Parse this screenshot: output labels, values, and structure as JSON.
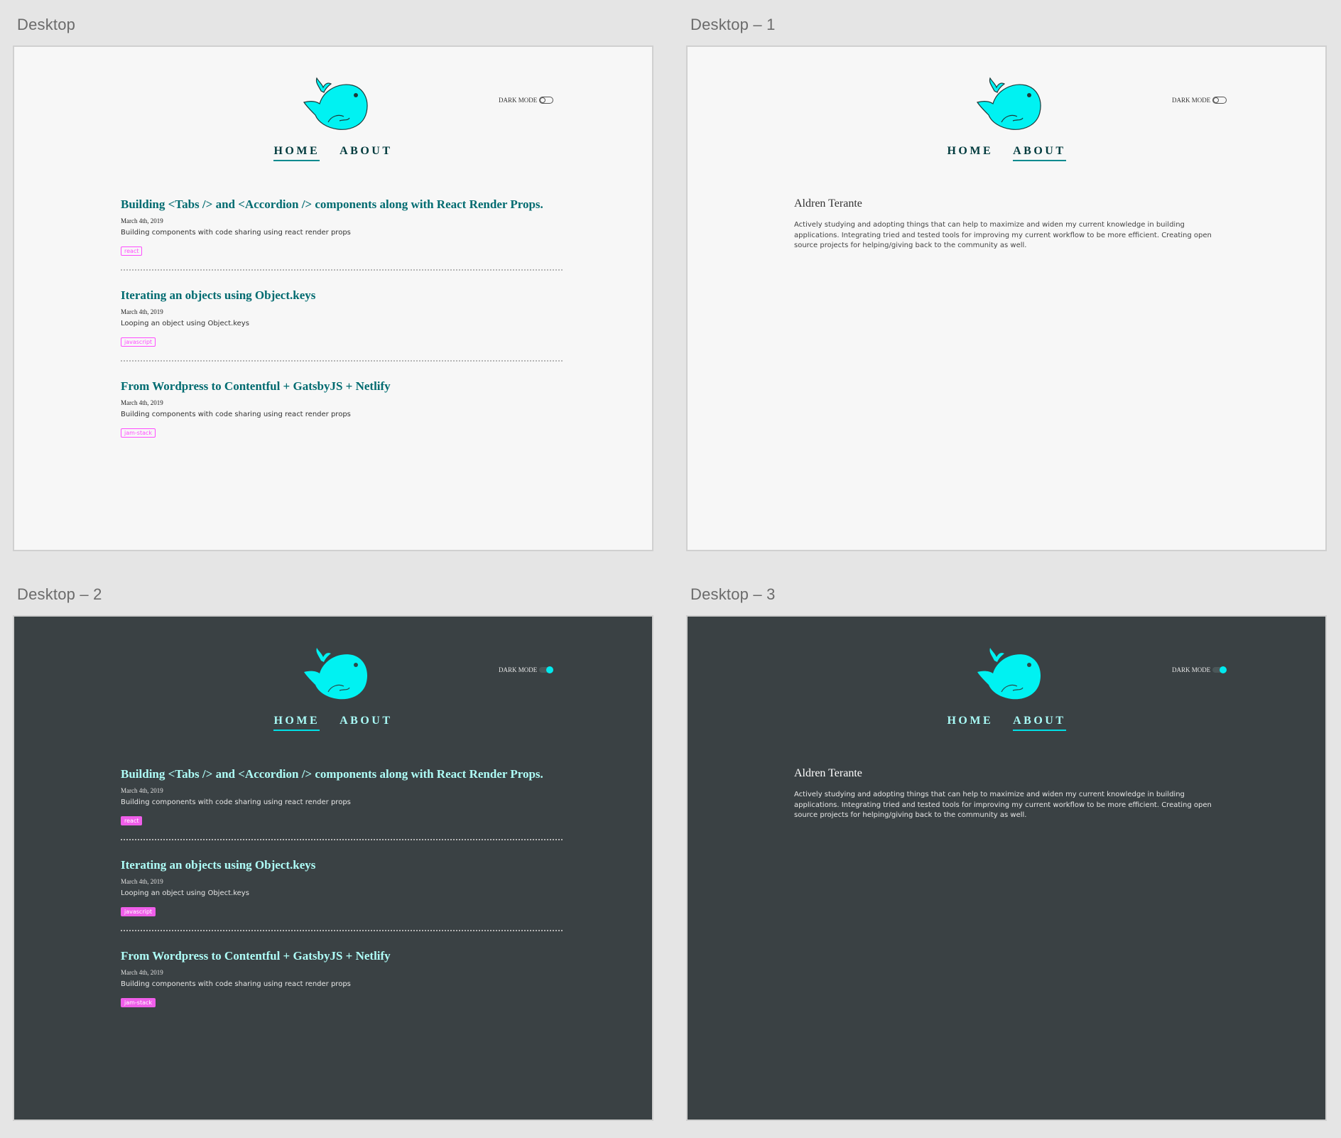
{
  "artboard_titles": [
    "Desktop",
    "Desktop – 1",
    "Desktop – 2",
    "Desktop – 3"
  ],
  "colors": {
    "canvas": "#e5e5e5",
    "light_bg": "#f7f7f7",
    "dark_bg": "#3a4144",
    "whale": "#00f2f2",
    "link_light": "#006b70",
    "link_dark": "#aefdf7",
    "tag": "#ff4cff"
  },
  "icons": {
    "logo": "whale-icon",
    "toggle": "toggle-switch-icon"
  },
  "header": {
    "dark_mode_label": "DARK MODE"
  },
  "nav": {
    "home": "HOME",
    "about": "ABOUT"
  },
  "posts": [
    {
      "title": "Building <Tabs /> and <Accordion /> components along with React Render Props.",
      "date": "March 4th, 2019",
      "description": "Building components with code sharing using react render props",
      "tag": "react"
    },
    {
      "title": "Iterating an objects using Object.keys",
      "date": "March 4th, 2019",
      "description": "Looping an object using Object.keys",
      "tag": "javascript"
    },
    {
      "title": "From Wordpress to Contentful + GatsbyJS + Netlify",
      "date": "March 4th, 2019",
      "description": "Building components with code sharing using react render props",
      "tag": "jam-stack"
    }
  ],
  "about": {
    "name": "Aldren Terante",
    "bio": "Actively studying and adopting things that can help to maximize and widen my current knowledge in building applications. Integrating tried and tested tools for improving my current workflow to be more efficient. Creating open source projects for helping/giving back to the community as well."
  }
}
